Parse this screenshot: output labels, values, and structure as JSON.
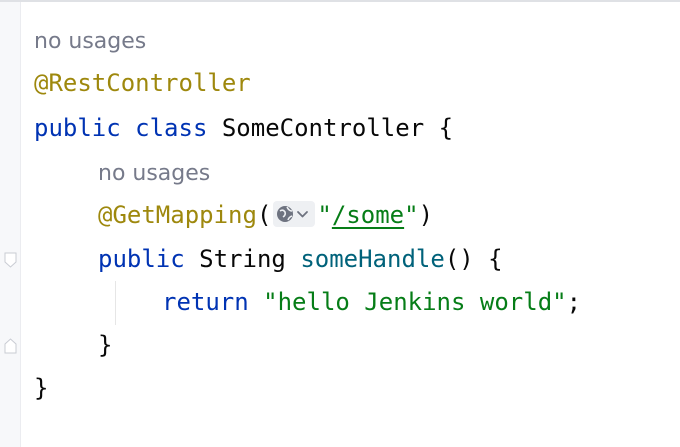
{
  "editor": {
    "hint_class_usages": "no usages",
    "annotation_class": "@RestController",
    "class_line": {
      "kw_public": "public",
      "kw_class": "class",
      "class_name": "SomeController",
      "brace_open": "{"
    },
    "hint_method_usages": "no usages",
    "mapping_line": {
      "annotation": "@GetMapping",
      "paren_open": "(",
      "quote_open": "\"",
      "path": "/some",
      "quote_close": "\"",
      "paren_close": ")"
    },
    "method_line": {
      "kw_public": "public",
      "return_type": "String",
      "method_name": "someHandle",
      "parens": "()",
      "brace_open": "{"
    },
    "return_line": {
      "kw_return": "return",
      "string_literal": "\"hello Jenkins world\"",
      "semicolon": ";"
    },
    "method_close": "}",
    "class_close": "}"
  },
  "icons": {
    "web_endpoint": "globe-icon",
    "endpoint_dropdown": "chevron-down-icon",
    "fold_start": "fold-start-icon",
    "fold_end": "fold-end-icon"
  },
  "colors": {
    "keyword": "#0033b3",
    "annotation": "#9e880d",
    "string": "#067d17",
    "method": "#00627a",
    "hint": "#767a8a"
  }
}
